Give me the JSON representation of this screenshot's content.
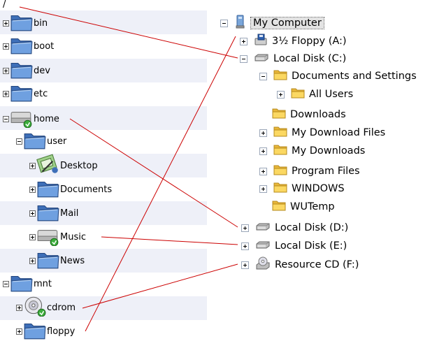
{
  "left_tree": {
    "root": "/",
    "items": [
      {
        "label": "bin",
        "expander": "plus",
        "icon": "folder-icon"
      },
      {
        "label": "boot",
        "expander": "plus",
        "icon": "folder-icon"
      },
      {
        "label": "dev",
        "expander": "plus",
        "icon": "folder-icon"
      },
      {
        "label": "etc",
        "expander": "plus",
        "icon": "folder-icon"
      },
      {
        "label": "home",
        "expander": "minus",
        "icon": "drive-icon"
      },
      {
        "label": "user",
        "expander": "minus",
        "icon": "folder-icon"
      },
      {
        "label": "Desktop",
        "expander": "plus",
        "icon": "desktop-icon"
      },
      {
        "label": "Documents",
        "expander": "plus",
        "icon": "folder-icon"
      },
      {
        "label": "Mail",
        "expander": "plus",
        "icon": "folder-icon"
      },
      {
        "label": "Music",
        "expander": "plus",
        "icon": "drive-icon"
      },
      {
        "label": "News",
        "expander": "plus",
        "icon": "folder-icon"
      },
      {
        "label": "mnt",
        "expander": "minus",
        "icon": "folder-icon"
      },
      {
        "label": "cdrom",
        "expander": "plus",
        "icon": "cdrom-icon"
      },
      {
        "label": "floppy",
        "expander": "plus",
        "icon": "folder-icon"
      }
    ]
  },
  "right_tree": {
    "items": [
      {
        "label": "My Computer",
        "expander": "minus",
        "icon": "computer-icon",
        "selected": true
      },
      {
        "label": "3½ Floppy (A:)",
        "expander": "plus",
        "icon": "floppy-icon"
      },
      {
        "label": "Local Disk (C:)",
        "expander": "minus",
        "icon": "disk-icon"
      },
      {
        "label": "Documents and Settings",
        "expander": "minus",
        "icon": "folder-icon"
      },
      {
        "label": "All Users",
        "expander": "plus",
        "icon": "folder-icon"
      },
      {
        "label": "Downloads",
        "expander": "none",
        "icon": "folder-icon"
      },
      {
        "label": "My Download Files",
        "expander": "plus",
        "icon": "folder-icon"
      },
      {
        "label": "My Downloads",
        "expander": "plus",
        "icon": "folder-icon"
      },
      {
        "label": "Program Files",
        "expander": "plus",
        "icon": "folder-icon"
      },
      {
        "label": "WINDOWS",
        "expander": "plus",
        "icon": "folder-icon"
      },
      {
        "label": "WUTemp",
        "expander": "none",
        "icon": "folder-icon"
      },
      {
        "label": "Local Disk (D:)",
        "expander": "plus",
        "icon": "disk-icon"
      },
      {
        "label": "Local Disk (E:)",
        "expander": "plus",
        "icon": "disk-icon"
      },
      {
        "label": "Resource CD (F:)",
        "expander": "plus",
        "icon": "cd-drive-icon"
      }
    ]
  },
  "mappings": [
    {
      "from": "/",
      "to": "Local Disk (C:)"
    },
    {
      "from": "home",
      "to": "Local Disk (D:)"
    },
    {
      "from": "Music",
      "to": "Local Disk (E:)"
    },
    {
      "from": "cdrom",
      "to": "Resource CD (F:)"
    },
    {
      "from": "floppy",
      "to": "3½ Floppy (A:)"
    }
  ],
  "colors": {
    "connector": "#cc0000",
    "row_stripe": "#eef0f8",
    "folder_fill": "#5b8fd6",
    "xp_folder_fill": "#f6d35a"
  }
}
